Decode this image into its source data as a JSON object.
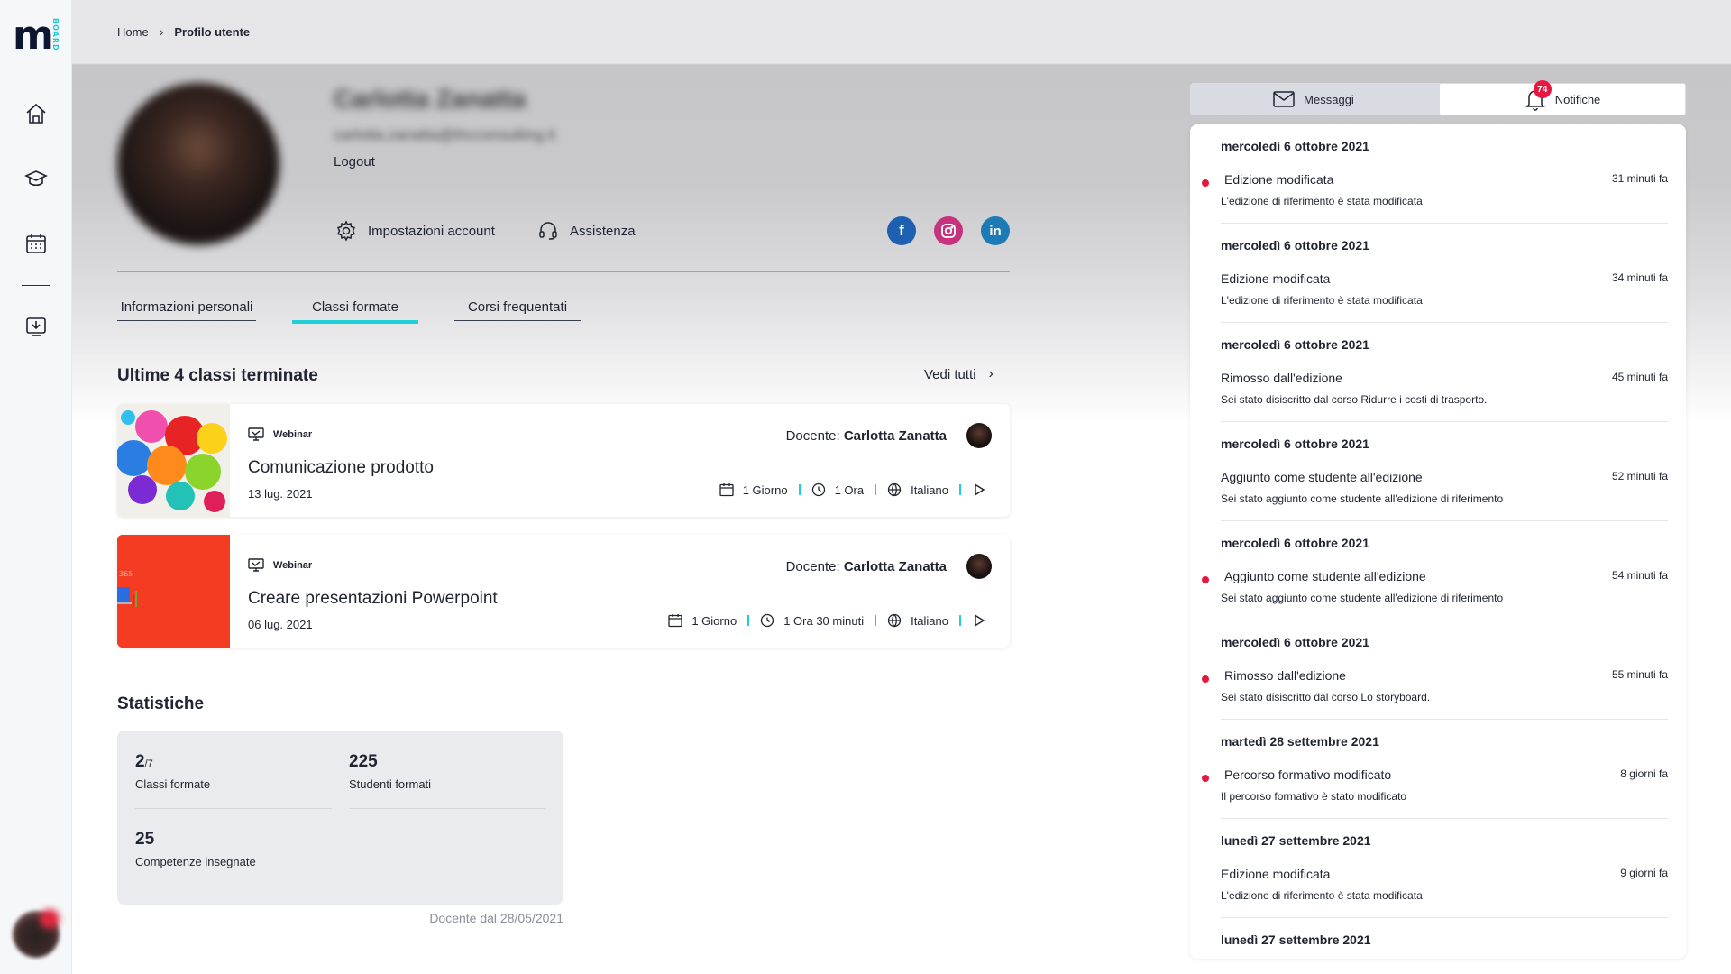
{
  "brand": {
    "logo_text": "m",
    "logo_sub": "BOARD",
    "accent": "#1fd0d6",
    "alert": "#e8173f"
  },
  "sidebar": {
    "items": [
      {
        "icon": "home-icon"
      },
      {
        "icon": "graduation-cap-icon"
      },
      {
        "icon": "calendar-icon"
      },
      {
        "icon": "download-icon"
      }
    ]
  },
  "breadcrumb": {
    "home": "Home",
    "current": "Profilo utente"
  },
  "profile": {
    "name": "Carlotta Zanatta",
    "email": "carlotta.zanatta@thcconsulting.it",
    "logout": "Logout",
    "settings_label": "Impostazioni account",
    "support_label": "Assistenza",
    "social": [
      {
        "icon": "facebook-icon",
        "glyph": "f",
        "color": "#1d5fb0"
      },
      {
        "icon": "instagram-icon",
        "glyph": "◎",
        "color": "#c5337f"
      },
      {
        "icon": "linkedin-icon",
        "glyph": "in",
        "color": "#1c7ab5"
      }
    ]
  },
  "tabs": [
    {
      "label": "Informazioni personali",
      "active": false
    },
    {
      "label": "Classi formate",
      "active": true
    },
    {
      "label": "Corsi frequentati",
      "active": false
    }
  ],
  "classes_section": {
    "title": "Ultime 4 classi terminate",
    "see_all": "Vedi tutti",
    "items": [
      {
        "type": "Webinar",
        "title": "Comunicazione prodotto",
        "date": "13 lug. 2021",
        "teacher_prefix": "Docente:",
        "teacher": "Carlotta Zanatta",
        "duration_days": "1 Giorno",
        "duration_hours": "1 Ora",
        "language": "Italiano"
      },
      {
        "type": "Webinar",
        "title": "Creare presentazioni Powerpoint",
        "date": "06 lug. 2021",
        "teacher_prefix": "Docente:",
        "teacher": "Carlotta Zanatta",
        "duration_days": "1 Giorno",
        "duration_hours": "1 Ora 30 minuti",
        "language": "Italiano",
        "thumb_text": "365"
      }
    ]
  },
  "stats": {
    "title": "Statistiche",
    "classes_value": "2",
    "classes_total": "/7",
    "classes_label": "Classi formate",
    "students_value": "225",
    "students_label": "Studenti formati",
    "skills_value": "25",
    "skills_label": "Competenze insegnate",
    "teacher_since": "Docente dal 28/05/2021"
  },
  "right_panel": {
    "tab_messages": "Messaggi",
    "tab_notifications": "Notifiche",
    "notifications_badge": "74",
    "notifications": [
      {
        "day": "mercoledì 6 ottobre 2021",
        "title": "Edizione modificata",
        "subtitle": "L'edizione di riferimento è stata modificata",
        "time": "31 minuti fa",
        "unread": true
      },
      {
        "day": "mercoledì 6 ottobre 2021",
        "title": "Edizione modificata",
        "subtitle": "L'edizione di riferimento è stata modificata",
        "time": "34 minuti fa",
        "unread": false
      },
      {
        "day": "mercoledì 6 ottobre 2021",
        "title": "Rimosso dall'edizione",
        "subtitle": "Sei stato disiscritto dal corso Ridurre i costi di trasporto.",
        "time": "45 minuti fa",
        "unread": false
      },
      {
        "day": "mercoledì 6 ottobre 2021",
        "title": "Aggiunto come studente all'edizione",
        "subtitle": "Sei stato aggiunto come studente all'edizione di riferimento",
        "time": "52 minuti fa",
        "unread": false
      },
      {
        "day": "mercoledì 6 ottobre 2021",
        "title": "Aggiunto come studente all'edizione",
        "subtitle": "Sei stato aggiunto come studente all'edizione di riferimento",
        "time": "54 minuti fa",
        "unread": true
      },
      {
        "day": "mercoledì 6 ottobre 2021",
        "title": "Rimosso dall'edizione",
        "subtitle": "Sei stato disiscritto dal corso Lo storyboard.",
        "time": "55 minuti fa",
        "unread": true
      },
      {
        "day": "martedì 28 settembre 2021",
        "title": "Percorso formativo modificato",
        "subtitle": "Il percorso formativo è stato modificato",
        "time": "8 giorni fa",
        "unread": true
      },
      {
        "day": "lunedì 27 settembre 2021",
        "title": "Edizione modificata",
        "subtitle": "L'edizione di riferimento è stata modificata",
        "time": "9 giorni fa",
        "unread": false
      },
      {
        "day": "lunedì 27 settembre 2021",
        "title": "",
        "subtitle": "",
        "time": "",
        "unread": false
      }
    ]
  }
}
